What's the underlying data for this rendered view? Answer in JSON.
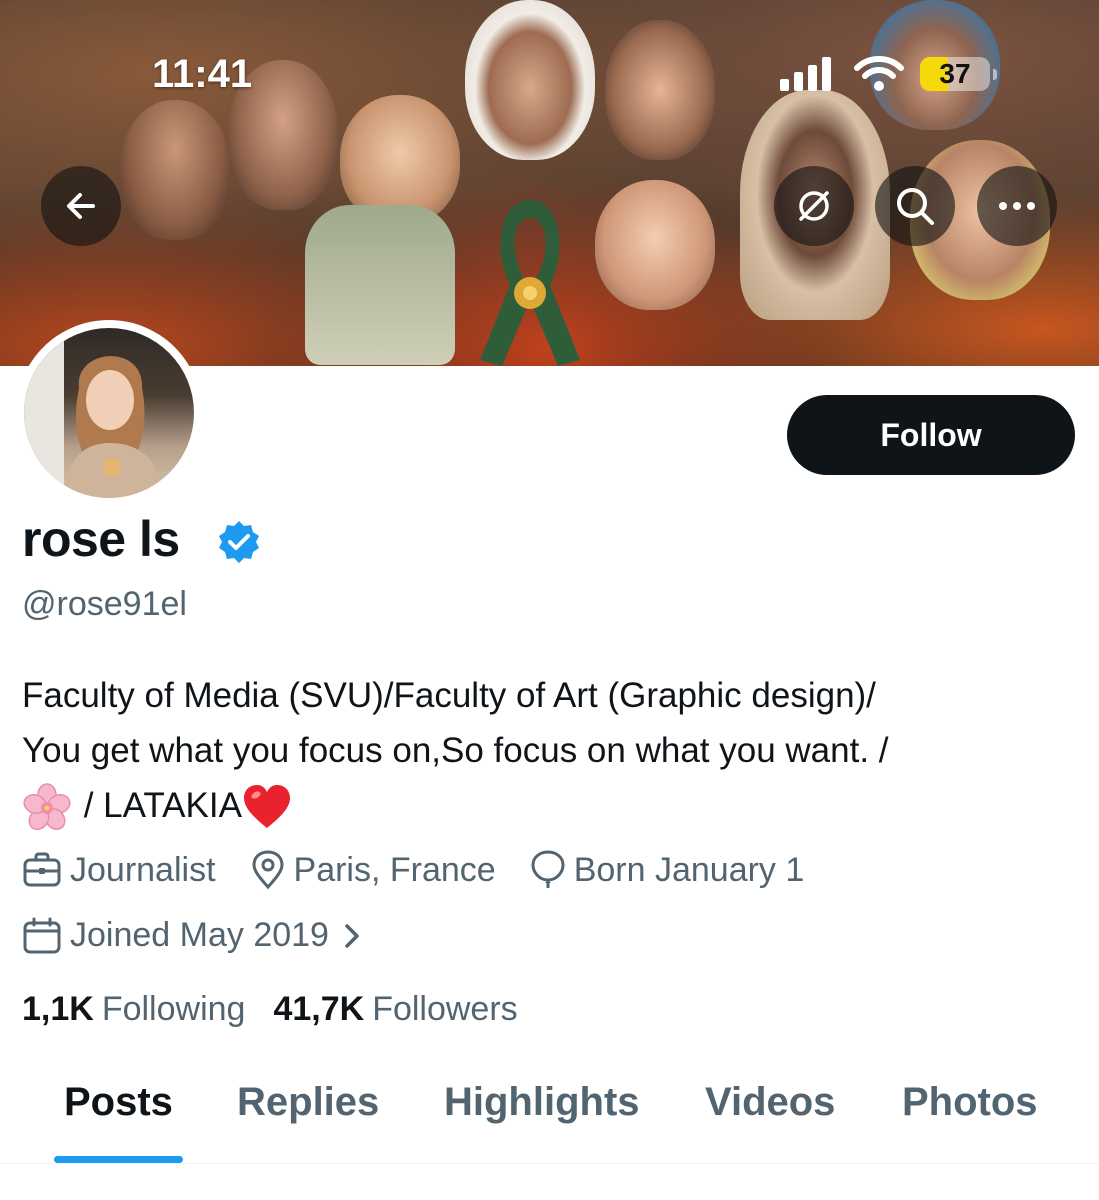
{
  "status_bar": {
    "time": "11:41",
    "battery": "37"
  },
  "header": {
    "back_icon": "arrow-left-icon",
    "actions": [
      "grok-icon",
      "search-icon",
      "more-icon"
    ]
  },
  "profile": {
    "follow_label": "Follow",
    "display_name": "rose ls",
    "verified_icon": "verified-badge-icon",
    "handle": "@rose91el",
    "bio": {
      "line1": "Faculty of Media (SVU)/Faculty of Art (Graphic design)/",
      "line2": "You get what you focus on,So focus on what you want. /",
      "line3_text": " / LATAKIA"
    },
    "meta": {
      "profession": "Journalist",
      "location": "Paris, France",
      "birthday": "Born January 1",
      "joined": "Joined May 2019"
    },
    "following_count": "1,1K",
    "following_label": "Following",
    "followers_count": "41,7K",
    "followers_label": "Followers"
  },
  "tabs": [
    "Posts",
    "Replies",
    "Highlights",
    "Videos",
    "Photos"
  ],
  "colors": {
    "accent": "#1d9bf0",
    "button": "#0f1419",
    "muted": "#536471",
    "battery": "#f5d90a"
  }
}
